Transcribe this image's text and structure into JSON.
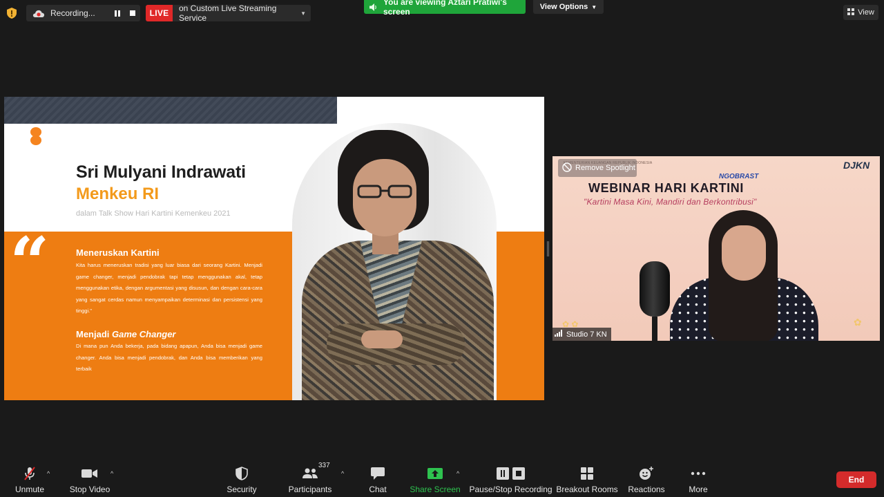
{
  "top_bar": {
    "recording_label": "Recording...",
    "live_badge": "LIVE",
    "live_service": "on Custom Live Streaming Service",
    "viewing_text": "You are viewing Aztari Pratiwi's screen",
    "view_options_label": "View Options",
    "view_label": "View"
  },
  "slide": {
    "name": "Sri Mulyani Indrawati",
    "role": "Menkeu RI",
    "context": "dalam Talk Show Hari Kartini Kemenkeu 2021",
    "quote_mark": "“",
    "section1_title": "Meneruskan Kartini",
    "section1_text": "Kita harus meneruskan tradisi yang luar biasa dari seorang Kartini. Menjadi game changer, menjadi pendobrak tapi tetap menggunakan akal, tetap menggunakan etika, dengan argumentasi yang disusun, dan dengan cara-cara yang sangat cerdas namun menyampaikan determinasi dan persistensi yang tinggi.\"",
    "section2_title_prefix": "Menjadi ",
    "section2_title_em": "Game Changer",
    "section2_text": "Di mana pun Anda bekerja, pada bidang apapun, Anda bisa menjadi game changer. Anda bisa menjadi pendobrak, dan Anda bisa memberikan yang terbaik"
  },
  "video": {
    "ministry_logo_text": "KEMENTERIAN KEUANGAN REPUBLIK INDONESIA",
    "remove_spotlight_label": "Remove Spotlight",
    "brand": "DJKN",
    "ngobrast": "NGOBRAST",
    "webinar_title": "WEBINAR HARI KARTINI",
    "webinar_subtitle": "\"Kartini Masa Kini, Mandiri dan Berkontribusi\"",
    "participant_name": "Studio 7 KN"
  },
  "toolbar": {
    "unmute": "Unmute",
    "stop_video": "Stop Video",
    "security": "Security",
    "participants": "Participants",
    "participants_count": "337",
    "chat": "Chat",
    "share_screen": "Share Screen",
    "pause_stop_recording": "Pause/Stop Recording",
    "breakout_rooms": "Breakout Rooms",
    "reactions": "Reactions",
    "more": "More",
    "end": "End"
  },
  "colors": {
    "background": "#1a1a1a",
    "live_red": "#e02828",
    "viewing_green": "#1fa53a",
    "slide_orange": "#ee7d12",
    "accent_yellow": "#f39a1b",
    "share_green": "#2ec24f",
    "end_red": "#d42b2b"
  }
}
